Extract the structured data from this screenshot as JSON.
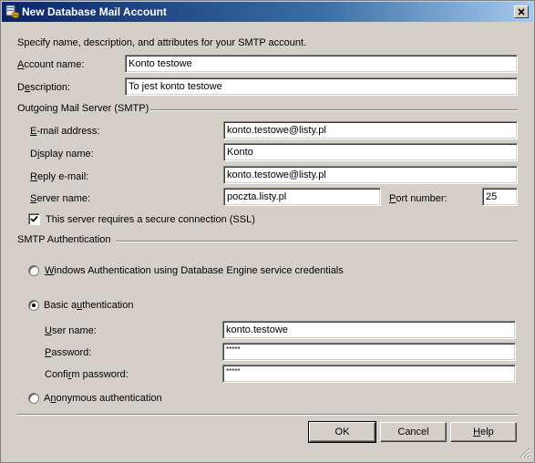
{
  "window": {
    "title": "New Database Mail Account"
  },
  "intro": "Specify name, description, and attributes for your SMTP account.",
  "account": {
    "name_label_ul": "A",
    "name_label_rest": "ccount name:",
    "name_value": "Konto testowe",
    "desc_label_pre": "D",
    "desc_label_ul": "e",
    "desc_label_rest": "scription:",
    "desc_value": "To jest konto testowe"
  },
  "smtp": {
    "group_title": "Outgoing Mail Server (SMTP)",
    "email_ul": "E",
    "email_rest": "-mail address:",
    "email_value": "konto.testowe@listy.pl",
    "display_pre": "D",
    "display_ul": "i",
    "display_rest": "splay name:",
    "display_value": "Konto",
    "reply_ul": "R",
    "reply_rest": "eply e-mail:",
    "reply_value": "konto.testowe@listy.pl",
    "server_ul": "S",
    "server_rest": "erver name:",
    "server_value": "poczta.listy.pl",
    "port_ul": "P",
    "port_rest": "ort number:",
    "port_value": "25",
    "ssl_label": "This server requires a secure connection (SSL)",
    "ssl_checked": true
  },
  "auth": {
    "group_title": "SMTP Authentication",
    "windows_ul": "W",
    "windows_rest": "indows Authentication using Database Engine service credentials",
    "basic_pre": "Basic a",
    "basic_ul": "u",
    "basic_rest": "thentication",
    "user_ul": "U",
    "user_rest": "ser name:",
    "user_value": "konto.testowe",
    "pass_ul": "P",
    "pass_rest": "assword:",
    "pass_value": "*****",
    "confirm_pre": "Confi",
    "confirm_ul": "r",
    "confirm_rest": "m password:",
    "confirm_value": "*****",
    "anon_pre": "A",
    "anon_ul": "n",
    "anon_rest": "onymous authentication",
    "selected": "basic"
  },
  "buttons": {
    "ok": "OK",
    "cancel": "Cancel",
    "help_ul": "H",
    "help_rest": "elp"
  },
  "icons": {
    "app": "database-mail-icon",
    "close": "close-icon",
    "grip": "resize-grip-icon"
  }
}
